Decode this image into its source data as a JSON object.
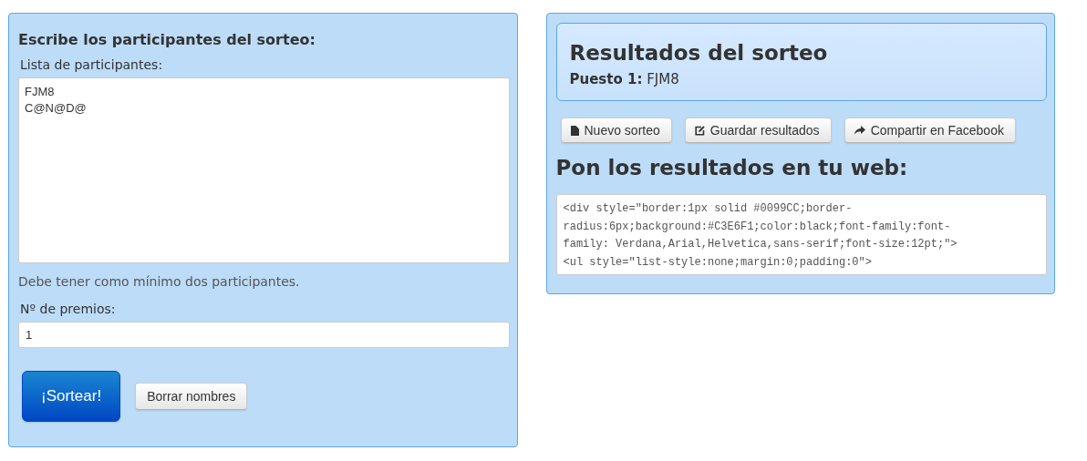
{
  "entry_panel": {
    "title": "Escribe los participantes del sorteo:",
    "participants_label": "Lista de participantes:",
    "participants": [
      "FJM8",
      "C@N@D@"
    ],
    "hint": "Debe tener como mínimo dos participantes.",
    "prizes_label": "Nº de premios:",
    "prizes_value": "1",
    "buttons": [
      {
        "kind": "primary",
        "label": "¡Sortear!"
      },
      {
        "kind": "default",
        "label": "Borrar nombres"
      }
    ]
  },
  "results_panel": {
    "title": "Resultados del sorteo",
    "results": [
      {
        "place": "Puesto 1:",
        "name": "FJM8"
      }
    ],
    "buttons": [
      {
        "kind": "file",
        "label": "Nuevo sorteo"
      },
      {
        "kind": "edit",
        "label": "Guardar resultados"
      },
      {
        "kind": "share",
        "label": "Compartir en Facebook"
      }
    ],
    "embed_title": "Pon los resultados en tu web:",
    "embed_code": [
      "<div style=\"border:1px solid #0099CC;border-",
      "radius:6px;background:#C3E6F1;color:black;font-family:font-",
      "family: Verdana,Arial,Helvetica,sans-serif;font-size:12pt;\">",
      "<ul style=\"list-style:none;margin:0;padding:0\">"
    ]
  }
}
